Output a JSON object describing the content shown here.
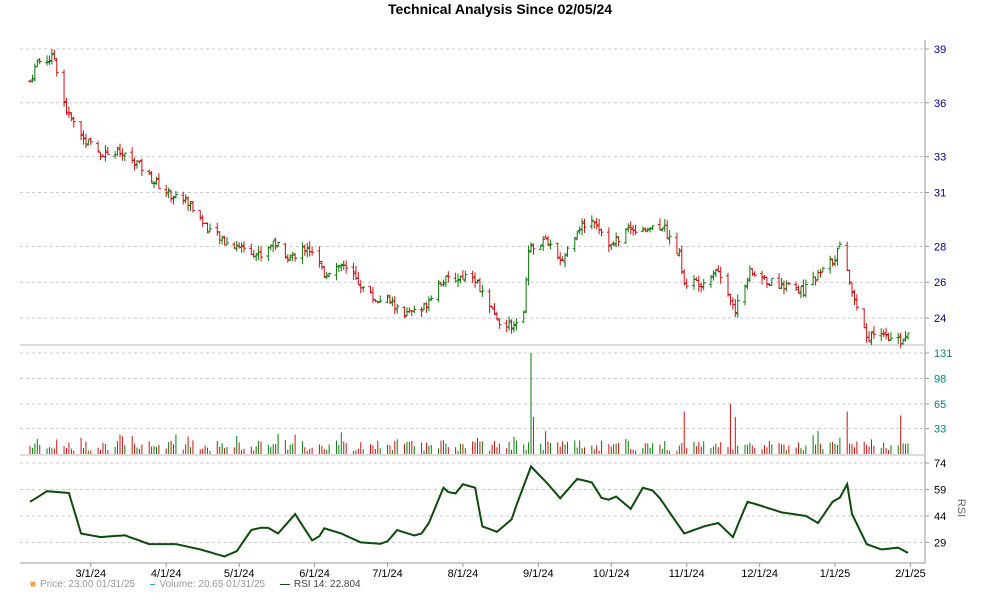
{
  "title": "Technical Analysis Since 02/05/24",
  "colors": {
    "up": "#0a7a0a",
    "down": "#cc1111",
    "rsi": "#0d4a0d",
    "grid": "#c8c8c8",
    "price_axis_text": "#000080",
    "volume_axis_text": "#008080",
    "rsi_axis_text": "#000000",
    "price_legend": "#f0a040",
    "volume_legend": "#20b0b0",
    "rsi_legend": "#0d4a0d"
  },
  "chart_data": {
    "type": "line",
    "panels": [
      "price",
      "volume",
      "rsi"
    ],
    "price_axis": {
      "ticks": [
        24,
        26,
        28,
        31,
        33,
        36,
        39
      ],
      "ylim": [
        22.5,
        39.5
      ]
    },
    "volume_axis": {
      "ticks": [
        33,
        65,
        98,
        131
      ],
      "ylim": [
        0,
        131
      ]
    },
    "rsi_axis": {
      "ticks": [
        29,
        44,
        59,
        74
      ],
      "ylim": [
        19,
        74
      ],
      "ylabel": "RSI"
    },
    "x_ticks": [
      "3/1/24",
      "4/1/24",
      "5/1/24",
      "6/1/24",
      "7/1/24",
      "8/1/24",
      "9/1/24",
      "10/1/24",
      "11/1/24",
      "12/1/24",
      "1/1/25",
      "2/1/25"
    ],
    "x_start": "2024-02-05",
    "x_end": "2025-02-07",
    "price_anchors": [
      [
        "2024-02-05",
        37.2
      ],
      [
        "2024-02-08",
        38.3
      ],
      [
        "2024-02-15",
        38.5
      ],
      [
        "2024-02-20",
        35.5
      ],
      [
        "2024-02-27",
        34.0
      ],
      [
        "2024-03-05",
        33.2
      ],
      [
        "2024-03-12",
        33.2
      ],
      [
        "2024-03-19",
        32.8
      ],
      [
        "2024-03-26",
        31.8
      ],
      [
        "2024-04-01",
        31.0
      ],
      [
        "2024-04-10",
        30.5
      ],
      [
        "2024-04-18",
        29.0
      ],
      [
        "2024-04-25",
        28.2
      ],
      [
        "2024-05-02",
        28.0
      ],
      [
        "2024-05-10",
        27.5
      ],
      [
        "2024-05-15",
        28.3
      ],
      [
        "2024-05-22",
        27.4
      ],
      [
        "2024-05-29",
        28.0
      ],
      [
        "2024-06-05",
        26.5
      ],
      [
        "2024-06-12",
        27.0
      ],
      [
        "2024-06-19",
        26.0
      ],
      [
        "2024-06-26",
        25.0
      ],
      [
        "2024-07-01",
        25.0
      ],
      [
        "2024-07-08",
        24.2
      ],
      [
        "2024-07-15",
        24.4
      ],
      [
        "2024-07-22",
        26.0
      ],
      [
        "2024-07-29",
        26.2
      ],
      [
        "2024-08-05",
        26.5
      ],
      [
        "2024-08-12",
        24.5
      ],
      [
        "2024-08-19",
        23.4
      ],
      [
        "2024-08-26",
        24.2
      ],
      [
        "2024-08-28",
        28.0
      ],
      [
        "2024-09-05",
        28.3
      ],
      [
        "2024-09-10",
        27.0
      ],
      [
        "2024-09-17",
        29.0
      ],
      [
        "2024-09-24",
        29.5
      ],
      [
        "2024-10-01",
        28.0
      ],
      [
        "2024-10-08",
        29.0
      ],
      [
        "2024-10-15",
        29.0
      ],
      [
        "2024-10-22",
        29.2
      ],
      [
        "2024-10-29",
        27.5
      ],
      [
        "2024-10-31",
        26.0
      ],
      [
        "2024-11-08",
        26.0
      ],
      [
        "2024-11-13",
        26.8
      ],
      [
        "2024-11-18",
        25.5
      ],
      [
        "2024-11-21",
        24.5
      ],
      [
        "2024-11-27",
        26.5
      ],
      [
        "2024-12-05",
        26.0
      ],
      [
        "2024-12-12",
        25.8
      ],
      [
        "2024-12-19",
        25.5
      ],
      [
        "2024-12-26",
        26.5
      ],
      [
        "2024-12-31",
        27.2
      ],
      [
        "2025-01-03",
        28.0
      ],
      [
        "2025-01-08",
        25.5
      ],
      [
        "2025-01-14",
        23.0
      ],
      [
        "2025-01-21",
        22.9
      ],
      [
        "2025-01-27",
        22.7
      ],
      [
        "2025-01-31",
        23.0
      ]
    ],
    "volume_spikes": [
      [
        "2024-02-25",
        45
      ],
      [
        "2024-04-21",
        38
      ],
      [
        "2024-05-24",
        25
      ],
      [
        "2024-06-12",
        28
      ],
      [
        "2024-08-29",
        131
      ],
      [
        "2024-08-30",
        48
      ],
      [
        "2024-10-31",
        55
      ],
      [
        "2024-11-19",
        65
      ],
      [
        "2024-11-21",
        48
      ],
      [
        "2025-01-05",
        60
      ],
      [
        "2025-01-06",
        55
      ],
      [
        "2025-01-28",
        50
      ]
    ],
    "rsi_anchors": [
      [
        "2024-02-05",
        52
      ],
      [
        "2024-02-12",
        58
      ],
      [
        "2024-02-21",
        57
      ],
      [
        "2024-02-26",
        34
      ],
      [
        "2024-03-05",
        32
      ],
      [
        "2024-03-15",
        33
      ],
      [
        "2024-03-25",
        28
      ],
      [
        "2024-04-05",
        28
      ],
      [
        "2024-04-15",
        25
      ],
      [
        "2024-04-25",
        21
      ],
      [
        "2024-04-30",
        24
      ],
      [
        "2024-05-06",
        36
      ],
      [
        "2024-05-12",
        38
      ],
      [
        "2024-05-17",
        34
      ],
      [
        "2024-05-24",
        45
      ],
      [
        "2024-06-01",
        28
      ],
      [
        "2024-06-05",
        37
      ],
      [
        "2024-06-12",
        34
      ],
      [
        "2024-06-20",
        29
      ],
      [
        "2024-06-30",
        28
      ],
      [
        "2024-07-05",
        36
      ],
      [
        "2024-07-14",
        32
      ],
      [
        "2024-07-18",
        40
      ],
      [
        "2024-07-24",
        60
      ],
      [
        "2024-07-28",
        55
      ],
      [
        "2024-08-01",
        62
      ],
      [
        "2024-08-06",
        60
      ],
      [
        "2024-08-09",
        38
      ],
      [
        "2024-08-15",
        35
      ],
      [
        "2024-08-21",
        42
      ],
      [
        "2024-08-23",
        50
      ],
      [
        "2024-08-29",
        72
      ],
      [
        "2024-09-05",
        62
      ],
      [
        "2024-09-10",
        54
      ],
      [
        "2024-09-17",
        65
      ],
      [
        "2024-09-23",
        63
      ],
      [
        "2024-09-28",
        52
      ],
      [
        "2024-10-03",
        55
      ],
      [
        "2024-10-09",
        48
      ],
      [
        "2024-10-14",
        60
      ],
      [
        "2024-10-19",
        58
      ],
      [
        "2024-10-26",
        44
      ],
      [
        "2024-10-31",
        34
      ],
      [
        "2024-11-08",
        38
      ],
      [
        "2024-11-14",
        40
      ],
      [
        "2024-11-20",
        32
      ],
      [
        "2024-11-26",
        52
      ],
      [
        "2024-12-01",
        50
      ],
      [
        "2024-12-10",
        46
      ],
      [
        "2024-12-20",
        44
      ],
      [
        "2024-12-25",
        40
      ],
      [
        "2024-12-31",
        52
      ],
      [
        "2025-01-05",
        56
      ],
      [
        "2025-01-06",
        62
      ],
      [
        "2025-01-08",
        45
      ],
      [
        "2025-01-14",
        28
      ],
      [
        "2025-01-20",
        25
      ],
      [
        "2025-01-27",
        26
      ],
      [
        "2025-01-31",
        23
      ]
    ]
  },
  "legend": {
    "price": "Price: 23.00  01/31/25",
    "volume": "Volume: 20.65  01/31/25",
    "rsi": "RSI 14: 22.804"
  }
}
